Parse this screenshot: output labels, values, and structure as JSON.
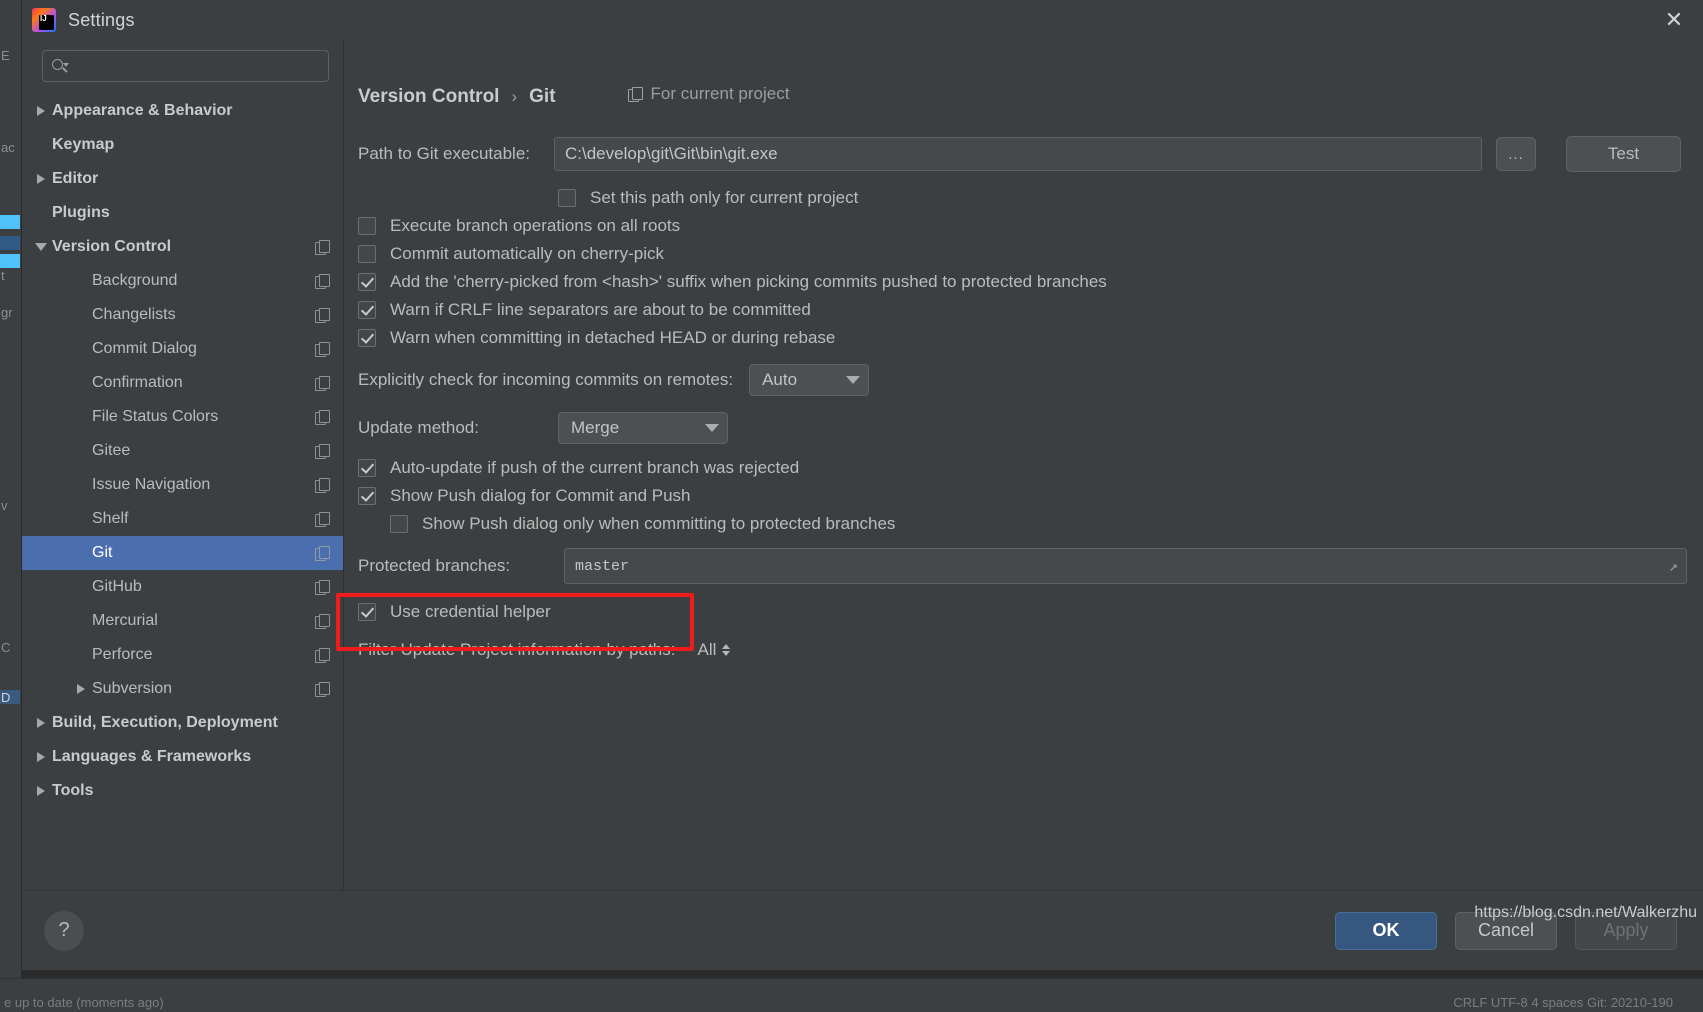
{
  "window": {
    "title": "Settings",
    "logo_icon": "intellij-idea-logo",
    "close_icon": "close-icon"
  },
  "search": {
    "value": "",
    "placeholder": "",
    "icon": "search-icon"
  },
  "sidebar": {
    "items": [
      {
        "label": "Appearance & Behavior",
        "level": 0,
        "bold": true,
        "arrow": "collapsed",
        "copy": false,
        "selected": false
      },
      {
        "label": "Keymap",
        "level": 0,
        "bold": true,
        "arrow": "none",
        "copy": false,
        "selected": false
      },
      {
        "label": "Editor",
        "level": 0,
        "bold": true,
        "arrow": "collapsed",
        "copy": false,
        "selected": false
      },
      {
        "label": "Plugins",
        "level": 0,
        "bold": true,
        "arrow": "none",
        "copy": false,
        "selected": false
      },
      {
        "label": "Version Control",
        "level": 0,
        "bold": true,
        "arrow": "expanded",
        "copy": true,
        "selected": false
      },
      {
        "label": "Background",
        "level": 1,
        "bold": false,
        "arrow": "none",
        "copy": true,
        "selected": false
      },
      {
        "label": "Changelists",
        "level": 1,
        "bold": false,
        "arrow": "none",
        "copy": true,
        "selected": false
      },
      {
        "label": "Commit Dialog",
        "level": 1,
        "bold": false,
        "arrow": "none",
        "copy": true,
        "selected": false
      },
      {
        "label": "Confirmation",
        "level": 1,
        "bold": false,
        "arrow": "none",
        "copy": true,
        "selected": false
      },
      {
        "label": "File Status Colors",
        "level": 1,
        "bold": false,
        "arrow": "none",
        "copy": true,
        "selected": false
      },
      {
        "label": "Gitee",
        "level": 1,
        "bold": false,
        "arrow": "none",
        "copy": true,
        "selected": false
      },
      {
        "label": "Issue Navigation",
        "level": 1,
        "bold": false,
        "arrow": "none",
        "copy": true,
        "selected": false
      },
      {
        "label": "Shelf",
        "level": 1,
        "bold": false,
        "arrow": "none",
        "copy": true,
        "selected": false
      },
      {
        "label": "Git",
        "level": 1,
        "bold": false,
        "arrow": "none",
        "copy": true,
        "selected": true
      },
      {
        "label": "GitHub",
        "level": 1,
        "bold": false,
        "arrow": "none",
        "copy": true,
        "selected": false
      },
      {
        "label": "Mercurial",
        "level": 1,
        "bold": false,
        "arrow": "none",
        "copy": true,
        "selected": false
      },
      {
        "label": "Perforce",
        "level": 1,
        "bold": false,
        "arrow": "none",
        "copy": true,
        "selected": false
      },
      {
        "label": "Subversion",
        "level": 1,
        "bold": false,
        "arrow": "collapsed",
        "copy": true,
        "selected": false
      },
      {
        "label": "Build, Execution, Deployment",
        "level": 0,
        "bold": true,
        "arrow": "collapsed",
        "copy": false,
        "selected": false
      },
      {
        "label": "Languages & Frameworks",
        "level": 0,
        "bold": true,
        "arrow": "collapsed",
        "copy": false,
        "selected": false
      },
      {
        "label": "Tools",
        "level": 0,
        "bold": true,
        "arrow": "collapsed",
        "copy": false,
        "selected": false
      }
    ]
  },
  "main": {
    "breadcrumb": {
      "parent": "Version Control",
      "separator": "›",
      "current": "Git"
    },
    "scope_label": "For current project",
    "scope_icon": "project-scope-icon",
    "path_label": "Path to Git executable:",
    "path_value": "C:\\develop\\git\\Git\\bin\\git.exe",
    "browse_label": "...",
    "test_label": "Test",
    "checkboxes": [
      {
        "label": "Set this path only for current project",
        "checked": false,
        "indent": 200
      },
      {
        "label": "Execute branch operations on all roots",
        "checked": false,
        "indent": 0
      },
      {
        "label": "Commit automatically on cherry-pick",
        "checked": false,
        "indent": 0
      },
      {
        "label": "Add the 'cherry-picked from <hash>' suffix when picking commits pushed to protected branches",
        "checked": true,
        "indent": 0
      },
      {
        "label": "Warn if CRLF line separators are about to be committed",
        "checked": true,
        "indent": 0
      },
      {
        "label": "Warn when committing in detached HEAD or during rebase",
        "checked": true,
        "indent": 0
      }
    ],
    "incoming_label": "Explicitly check for incoming commits on remotes:",
    "incoming_value": "Auto",
    "update_method_label": "Update method:",
    "update_method_value": "Merge",
    "checkboxes2": [
      {
        "label": "Auto-update if push of the current branch was rejected",
        "checked": true,
        "indent": 0
      },
      {
        "label": "Show Push dialog for Commit and Push",
        "checked": true,
        "indent": 0
      },
      {
        "label": "Show Push dialog only when committing to protected branches",
        "checked": false,
        "indent": 32
      }
    ],
    "protected_label": "Protected branches:",
    "protected_value": "master",
    "expand_icon": "expand-field-icon",
    "credential_label": "Use credential helper",
    "credential_checked": true,
    "filter_label": "Filter Update Project information by paths:",
    "filter_value": "All",
    "filter_icon": "updown-spinner-icon"
  },
  "footer": {
    "help_label": "?",
    "help_icon": "help-icon",
    "ok_label": "OK",
    "cancel_label": "Cancel",
    "apply_label": "Apply"
  },
  "watermark": "https://blog.csdn.net/Walkerzhu",
  "background": {
    "left_glyphs": [
      "E",
      "ac",
      "t",
      "gr",
      "v",
      "C",
      "D"
    ],
    "bottom_left_text": "e up to date (moments ago)",
    "bottom_right_text": "CRLF    UTF-8    4 spaces    Git: 20210-190"
  },
  "colors": {
    "accent_selection": "#4b6eaf",
    "primary_button": "#365880",
    "annotation": "#f01b1b",
    "window_bg": "#3c3f41"
  }
}
